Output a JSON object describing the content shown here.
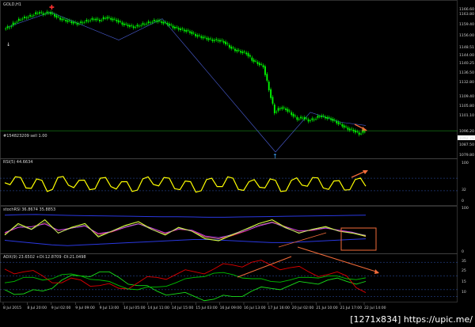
{
  "colors": {
    "bull": "#00ff00",
    "bear": "#00ff00",
    "rsi": "#ffff00",
    "adxMain": "#00c000",
    "plusDI": "#e00000",
    "minusDI": "#19e019",
    "annot": "#f26b3a",
    "zigzag": "#4b5fd8",
    "level": "#1fae1f",
    "axisLine": "#4d4d4d"
  },
  "main": {
    "label": "GOLD,H1",
    "order_label": "#154823209 sell 1.00",
    "price_axis": [
      "1166.60",
      "1163.80",
      "1159.40",
      "1156.00",
      "1148.51",
      "1144.00",
      "1140.25",
      "1136.50",
      "1132.80",
      "1109.40",
      "1105.80",
      "1101.10",
      "1096.20",
      "1092.76",
      "1087.50",
      "1079.80"
    ],
    "current_price": "1092.76"
  },
  "rsi": {
    "label": "RSI(5) 44.6634",
    "axis": [
      "100",
      "32",
      "0"
    ]
  },
  "stoch": {
    "label": "stochRSI 36.8674 35.8853",
    "axis": [
      "100",
      "0"
    ]
  },
  "adx": {
    "label": "ADX(9) 23.6502 +DI:12.8709 -DI:21.0498",
    "axis": [
      "35",
      "25",
      "15",
      "10"
    ]
  },
  "time_axis": [
    "8 Jul 2015",
    "8 Jul 20:00",
    "9 Jul 02:00",
    "9 Jul 09:00",
    "9 Jul 13:00",
    "14 Jul 05:00",
    "14 Jul 11:00",
    "14 Jul 15:00",
    "15 Jul 03:00",
    "16 Jul 09:00",
    "16 Jul 13:00",
    "17 Jul 16:00",
    "20 Jul 02:00",
    "21 Jul 10:00",
    "21 Jul 17:00",
    "22 Jul 14:00"
  ],
  "watermark": "[1271x834] https://upic.me/",
  "chart_data": [
    {
      "type": "candlestick",
      "title": "GOLD,H1",
      "y_axis_labels": [
        "1166.60",
        "1163.80",
        "1159.40",
        "1156.00",
        "1148.51",
        "1144.00",
        "1140.25",
        "1136.50",
        "1132.80",
        "1109.40",
        "1105.80",
        "1101.10",
        "1096.20",
        "1092.76",
        "1087.50",
        "1079.80"
      ],
      "close": [
        1156,
        1159,
        1161,
        1162,
        1163,
        1165,
        1164,
        1165,
        1163,
        1161,
        1160,
        1159,
        1158,
        1159,
        1160,
        1161,
        1160,
        1162,
        1161,
        1160,
        1158,
        1157,
        1156,
        1157,
        1158,
        1159,
        1160,
        1159,
        1158,
        1156,
        1155,
        1154,
        1153,
        1151,
        1150,
        1149,
        1148,
        1148,
        1147,
        1144,
        1142,
        1141,
        1140,
        1136,
        1134,
        1132,
        1118,
        1104,
        1107,
        1106,
        1103,
        1100,
        1101,
        1099,
        1100,
        1102,
        1101,
        1100,
        1098,
        1096,
        1094,
        1093,
        1091,
        1092.76
      ]
    },
    {
      "type": "line",
      "title": "RSI(5) 44.6634",
      "y_axis_labels": [
        "100",
        "32",
        "0"
      ],
      "y": [
        55,
        72,
        40,
        66,
        30,
        70,
        48,
        62,
        35,
        68,
        44,
        58,
        30,
        66,
        50,
        70,
        38,
        60,
        28,
        64,
        44,
        72,
        36,
        58,
        42,
        66,
        30,
        62,
        48,
        70,
        40,
        60,
        34,
        64,
        45
      ]
    },
    {
      "type": "line",
      "title": "stochRSI 36.8674 35.8853",
      "y_axis_labels": [
        "100",
        "0"
      ],
      "series": [
        {
          "values": [
            40,
            70,
            55,
            80,
            45,
            60,
            70,
            35,
            50,
            65,
            75,
            55,
            40,
            60,
            50,
            30,
            25,
            40,
            55,
            70,
            80,
            60,
            45,
            55,
            62,
            50,
            45,
            36.8674
          ]
        },
        {
          "values": [
            45,
            60,
            62,
            70,
            52,
            58,
            64,
            42,
            48,
            60,
            70,
            58,
            44,
            55,
            52,
            35,
            30,
            38,
            50,
            64,
            74,
            62,
            50,
            52,
            58,
            52,
            46,
            35.8853
          ]
        }
      ]
    },
    {
      "type": "line",
      "title": "ADX(9) 23.6502 +DI:12.8709 -DI:21.0498",
      "y_axis_labels": [
        "35",
        "25",
        "15",
        "10"
      ],
      "series": [
        {
          "values": [
            20,
            24,
            22,
            26,
            25,
            22,
            18,
            15,
            17,
            20,
            24,
            27,
            26,
            23,
            21,
            22,
            24,
            25,
            23,
            23.6502
          ]
        },
        {
          "values": [
            30,
            28,
            25,
            20,
            22,
            18,
            16,
            20,
            24,
            26,
            28,
            30,
            33,
            35,
            33,
            31,
            28,
            26,
            25,
            12.8709
          ]
        },
        {
          "values": [
            15,
            12,
            14,
            22,
            25,
            28,
            24,
            18,
            14,
            12,
            10,
            8,
            10,
            14,
            16,
            18,
            20,
            22,
            21,
            21.0498
          ]
        }
      ]
    }
  ]
}
